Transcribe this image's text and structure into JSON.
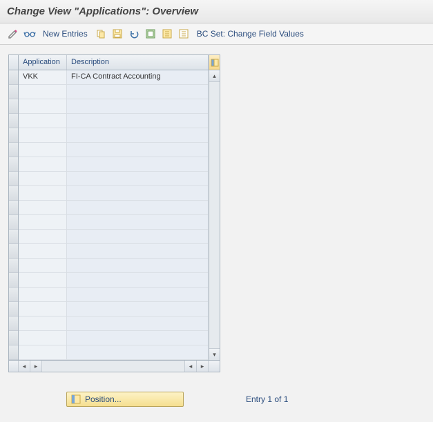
{
  "title": "Change View \"Applications\": Overview",
  "toolbar": {
    "new_entries": "New Entries",
    "bc_set": "BC Set: Change Field Values"
  },
  "table": {
    "headers": {
      "application": "Application",
      "description": "Description"
    },
    "rows": [
      {
        "application": "VKK",
        "description": "FI-CA Contract Accounting"
      }
    ],
    "blank_rows": 19
  },
  "footer": {
    "position_label": "Position...",
    "entry_text": "Entry 1 of 1"
  }
}
